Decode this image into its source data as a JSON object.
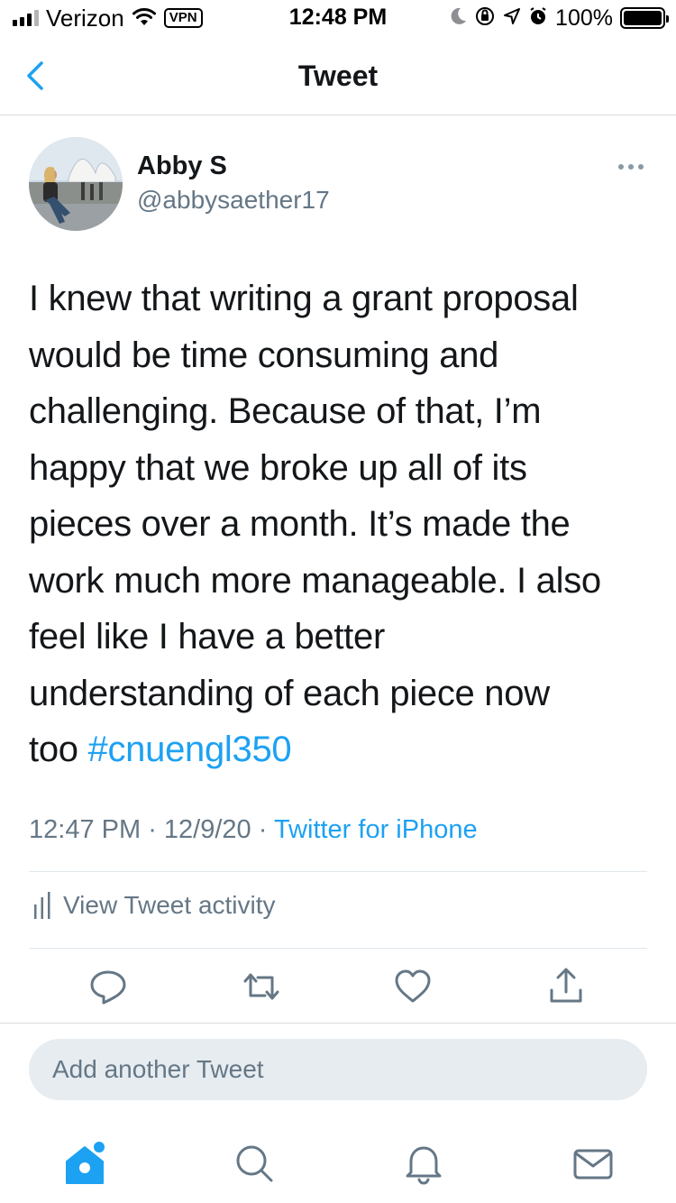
{
  "status_bar": {
    "carrier": "Verizon",
    "vpn": "VPN",
    "time": "12:48 PM",
    "battery": "100%"
  },
  "nav": {
    "title": "Tweet",
    "back_icon": "chevron-left-icon"
  },
  "tweet": {
    "author_name": "Abby S",
    "author_handle": "@abbysaether17",
    "text_lines": [
      "I knew that writing a grant proposal",
      "would be time consuming and",
      "challenging. Because of that, I’m",
      "happy that we broke up all of its",
      "pieces over a month. It’s made the",
      "work much more manageable. I also",
      "feel like I have a better",
      "understanding of each piece now",
      "too "
    ],
    "hashtag": "#cnuengl350",
    "time": "12:47 PM",
    "date": "12/9/20",
    "separator": " · ",
    "source": "Twitter for iPhone",
    "activity_label": "View Tweet activity"
  },
  "actions": [
    "reply-icon",
    "retweet-icon",
    "like-icon",
    "share-icon"
  ],
  "compose": {
    "placeholder": "Add another Tweet"
  },
  "tabs": [
    "home-icon",
    "search-icon",
    "notifications-icon",
    "messages-icon"
  ],
  "colors": {
    "accent": "#1da1f2",
    "secondary_text": "#657786",
    "primary_text": "#14171a",
    "divider": "#e1e8ed",
    "compose_bg": "#e6ecf0"
  }
}
